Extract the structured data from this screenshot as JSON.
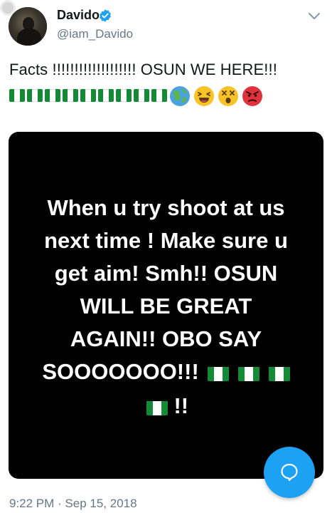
{
  "tweet": {
    "author_name": "Davido",
    "author_handle": "@iam_Davido",
    "text": "Facts !!!!!!!!!!!!!!!!!!! OSUN WE HERE!!!",
    "emoji_row": [
      "nigeria-flag",
      "nigeria-flag",
      "nigeria-flag",
      "nigeria-flag",
      "nigeria-flag",
      "nigeria-flag",
      "nigeria-flag",
      "nigeria-flag",
      "nigeria-flag",
      "globe-emoji",
      "laughing-emoji",
      "dizzy-face-emoji",
      "angry-face-emoji"
    ],
    "timestamp": "9:22 PM · Sep 15, 2018"
  },
  "media": {
    "lines": [
      "When u try shoot at us",
      "next time ! Make sure u",
      "get aim! Smh!! OSUN",
      "WILL BE GREAT",
      "AGAIN!! OBO SAY",
      "SOOOOOOO!!!",
      "!!"
    ]
  },
  "colors": {
    "accent": "#1da1f2",
    "text_secondary": "#657786",
    "flag_green": "#138a36"
  },
  "icons": {
    "verified": "verified-badge-icon",
    "menu": "chevron-down-icon",
    "fab": "compose-reply-icon"
  }
}
